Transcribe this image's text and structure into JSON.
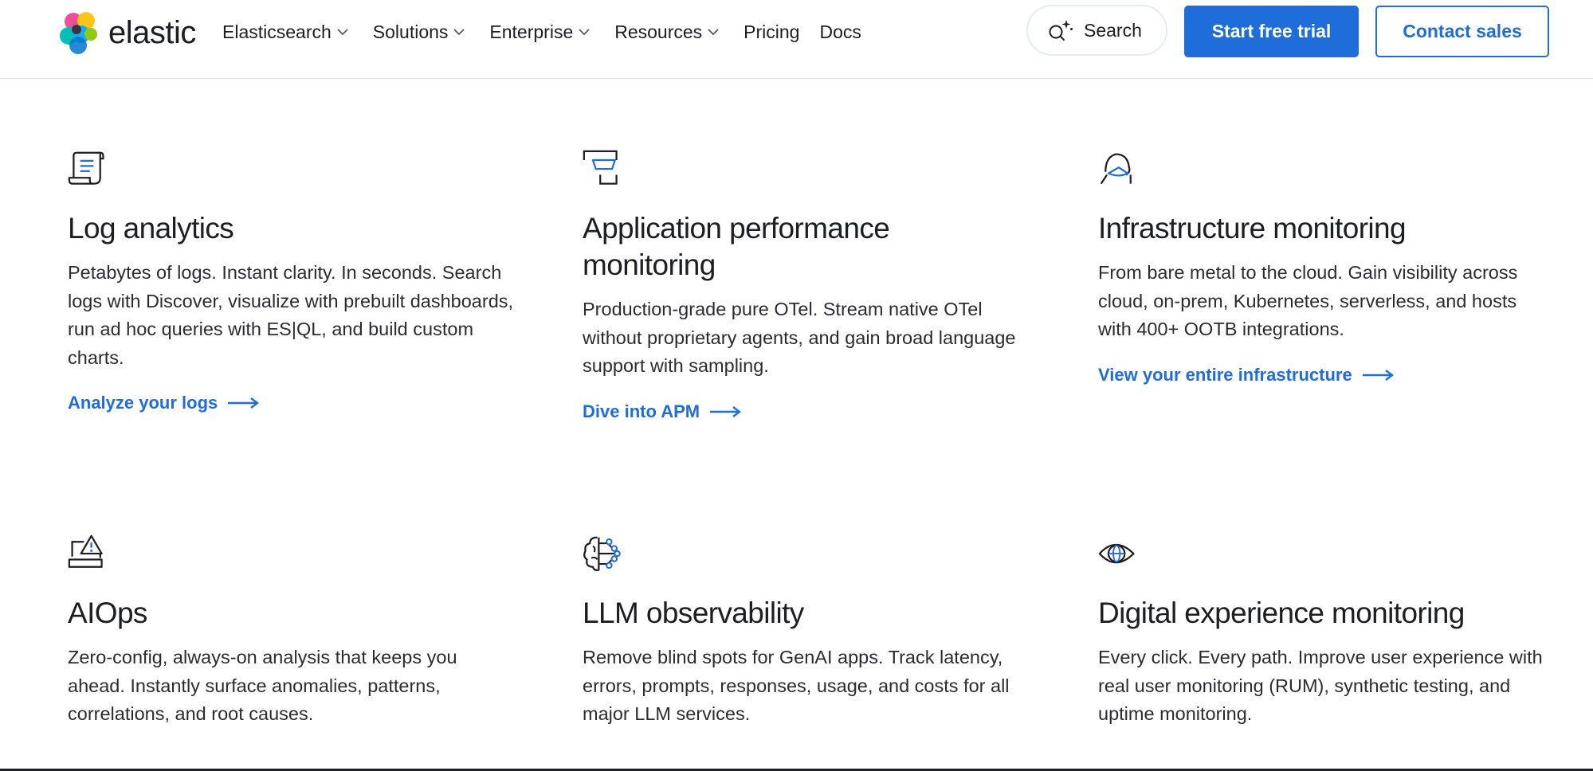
{
  "header": {
    "logo_text": "elastic",
    "nav": [
      {
        "label": "Elasticsearch",
        "dropdown": true
      },
      {
        "label": "Solutions",
        "dropdown": true
      },
      {
        "label": "Enterprise",
        "dropdown": true
      },
      {
        "label": "Resources",
        "dropdown": true
      },
      {
        "label": "Pricing",
        "dropdown": false
      },
      {
        "label": "Docs",
        "dropdown": false
      }
    ],
    "search_label": "Search",
    "trial_label": "Start free trial",
    "contact_label": "Contact sales"
  },
  "colors": {
    "accent": "#1f6ddb",
    "text": "#1d1e24",
    "icon": "#1d1e24"
  },
  "cards": [
    {
      "icon": "scroll-document-icon",
      "title": "Log analytics",
      "body": "Petabytes of logs. Instant clarity. In seconds. Search logs with Discover, visualize with prebuilt dashboards, run ad hoc queries with ES|QL, and build custom charts.",
      "link": "Analyze your logs"
    },
    {
      "icon": "application-performance-icon",
      "title": "Application performance monitoring",
      "body": "Production-grade pure OTel. Stream native OTel without proprietary agents, and gain broad language support with sampling.",
      "link": "Dive into APM"
    },
    {
      "icon": "infrastructure-cloud-icon",
      "title": "Infrastructure monitoring",
      "body": "From bare metal to the cloud. Gain visibility across cloud, on-prem, Kubernetes, serverless, and hosts with 400+ OOTB integrations.",
      "link": "View your entire infrastructure"
    },
    {
      "icon": "laptop-warning-icon",
      "title": "AIOps",
      "body": "Zero-config, always-on analysis that keeps you ahead. Instantly surface anomalies, patterns, correlations, and root causes.",
      "link": ""
    },
    {
      "icon": "brain-network-icon",
      "title": "LLM observability",
      "body": "Remove blind spots for GenAI apps. Track latency, errors, prompts, responses, usage, and costs for all major LLM services.",
      "link": ""
    },
    {
      "icon": "eye-globe-icon",
      "title": "Digital experience monitoring",
      "body": "Every click. Every path. Improve user experience with real user monitoring (RUM), synthetic testing, and uptime monitoring.",
      "link": ""
    }
  ]
}
